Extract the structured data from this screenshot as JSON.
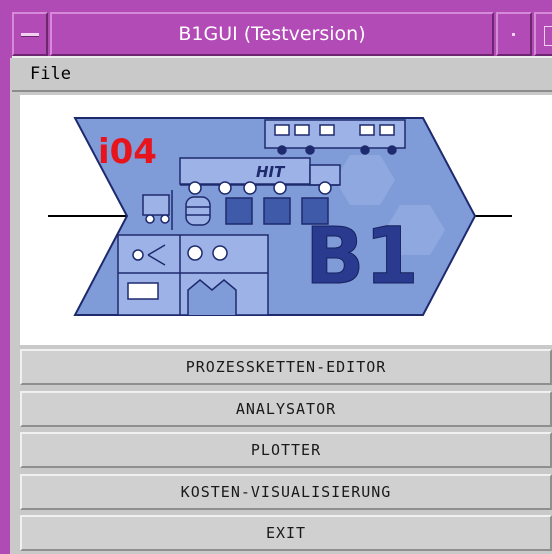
{
  "window": {
    "title": "B1GUI (Testversion)",
    "frame_color": "#b04ab4"
  },
  "menubar": {
    "file_label": "File"
  },
  "logo": {
    "left_label": "i04",
    "truck_label": "HIT",
    "main_label": "B1",
    "colors": {
      "arrow_fill": "#7f9bd8",
      "dark_blue": "#2a3b8f",
      "red_text": "#e8141c"
    }
  },
  "buttons": [
    {
      "label": "PROZESSKETTEN-EDITOR"
    },
    {
      "label": "ANALYSATOR"
    },
    {
      "label": "PLOTTER"
    },
    {
      "label": "KOSTEN-VISUALISIERUNG"
    },
    {
      "label": "EXIT"
    }
  ]
}
